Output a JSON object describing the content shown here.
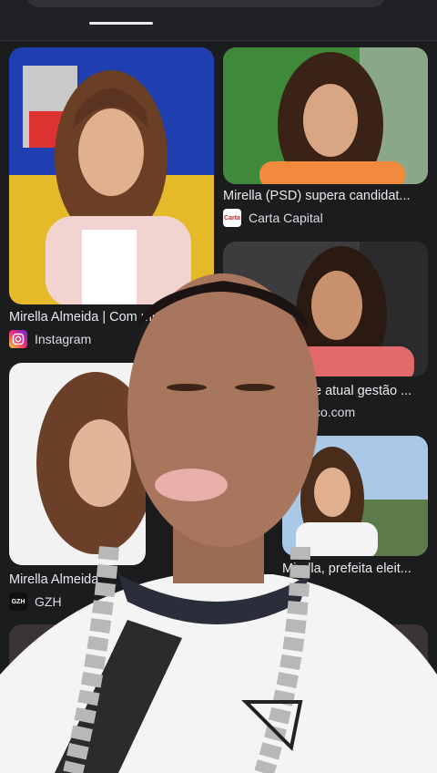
{
  "results": [
    {
      "caption": "Mirella Almeida | Com mu",
      "source": "Instagram",
      "icon": "instagram-icon",
      "icon_color": "#d62976"
    },
    {
      "caption": "Mirella (PSD) supera candidat...",
      "source": "Carta Capital",
      "icon": "carta-capital-icon",
      "icon_text": "Carta",
      "icon_color": "#c62828"
    },
    {
      "caption": "e atual gestão ...",
      "source": "co.com"
    },
    {
      "caption": "Mirella Almeida",
      "source": "GZH",
      "icon": "gzh-icon",
      "icon_text": "GZH",
      "icon_color": "#111111"
    },
    {
      "caption": "Mirella, prefeita eleit...",
      "source": ""
    }
  ]
}
